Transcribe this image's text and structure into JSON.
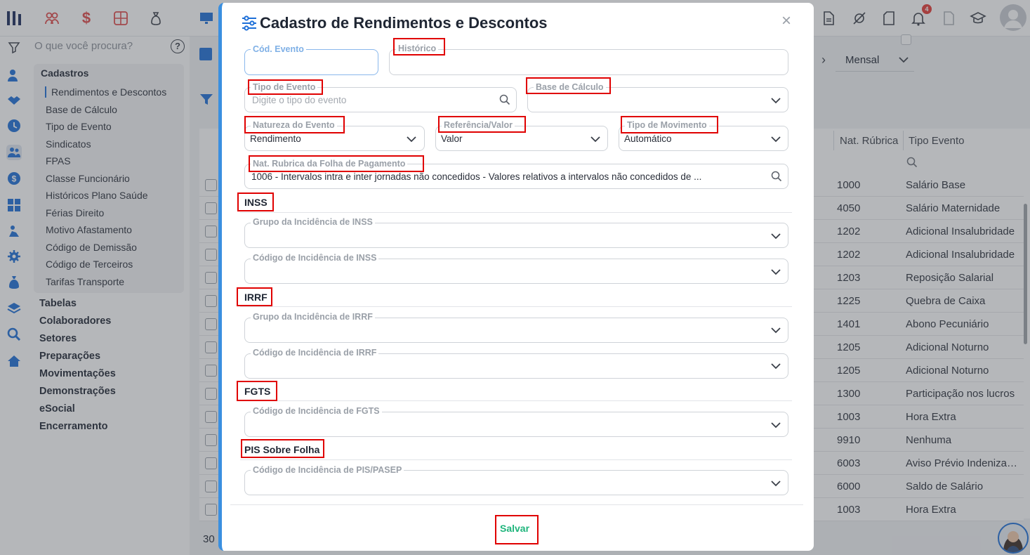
{
  "search_placeholder": "O que você procura?",
  "notification_count": "4",
  "sidebar": {
    "group_title": "Cadastros",
    "items": [
      "Rendimentos e Descontos",
      "Base de Cálculo",
      "Tipo de Evento",
      "Sindicatos",
      "FPAS",
      "Classe Funcionário",
      "Históricos Plano Saúde",
      "Férias Direito",
      "Motivo Afastamento",
      "Código de Demissão",
      "Código de Terceiros",
      "Tarifas Transporte"
    ],
    "menus": [
      "Tabelas",
      "Colaboradores",
      "Setores",
      "Preparações",
      "Movimentações",
      "Demonstrações",
      "eSocial",
      "Encerramento"
    ]
  },
  "period_select": "Mensal",
  "table": {
    "headers": [
      "Nat. Rúbrica",
      "Tipo Evento"
    ],
    "rows": [
      [
        "1000",
        "Salário Base"
      ],
      [
        "4050",
        "Salário Maternidade"
      ],
      [
        "1202",
        "Adicional Insalubridade"
      ],
      [
        "1202",
        "Adicional Insalubridade"
      ],
      [
        "1203",
        "Reposição Salarial"
      ],
      [
        "1225",
        "Quebra de Caixa"
      ],
      [
        "1401",
        "Abono Pecuniário"
      ],
      [
        "1205",
        "Adicional Noturno"
      ],
      [
        "1205",
        "Adicional Noturno"
      ],
      [
        "1300",
        "Participação nos lucros"
      ],
      [
        "1003",
        "Hora Extra"
      ],
      [
        "9910",
        "Nenhuma"
      ],
      [
        "6003",
        "Aviso Prévio Indenizado"
      ],
      [
        "6000",
        "Saldo de Salário"
      ],
      [
        "1003",
        "Hora Extra"
      ]
    ],
    "page_size": "30"
  },
  "modal": {
    "title": "Cadastro de Rendimentos e Descontos",
    "fields": {
      "cod_evento": {
        "label": "Cód. Evento",
        "value": ""
      },
      "historico": {
        "label": "Histórico",
        "value": ""
      },
      "tipo_evento": {
        "label": "Tipo de Evento",
        "placeholder": "Digite o tipo do evento"
      },
      "base_calculo": {
        "label": "Base de Cálculo",
        "value": ""
      },
      "natureza_evento": {
        "label": "Natureza do Evento",
        "value": "Rendimento"
      },
      "referencia_valor": {
        "label": "Referência/Valor",
        "value": "Valor"
      },
      "tipo_movimento": {
        "label": "Tipo de Movimento",
        "value": "Automático"
      },
      "nat_rubrica": {
        "label": "Nat. Rubrica da Folha de Pagamento",
        "value": "1006 - Intervalos intra e inter jornadas não concedidos - Valores relativos a intervalos não concedidos de ..."
      }
    },
    "sections": {
      "inss": {
        "title": "INSS",
        "fields": [
          "Grupo da Incidência de INSS",
          "Código de Incidência de INSS"
        ]
      },
      "irrf": {
        "title": "IRRF",
        "fields": [
          "Grupo da Incidência de IRRF",
          "Código de Incidência de IRRF"
        ]
      },
      "fgts": {
        "title": "FGTS",
        "fields": [
          "Código de Incidência de FGTS"
        ]
      },
      "pis": {
        "title": "PIS Sobre Folha",
        "fields": [
          "Código de Incidência de PIS/PASEP"
        ]
      }
    },
    "save_label": "Salvar"
  }
}
